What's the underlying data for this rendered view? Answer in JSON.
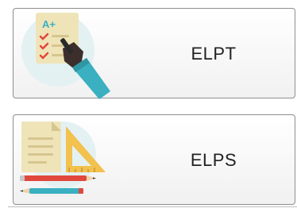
{
  "tiles": [
    {
      "label": "ELPT",
      "icon": "graded-test-icon"
    },
    {
      "label": "ELPS",
      "icon": "stationery-icon"
    }
  ],
  "colors": {
    "tile_border": "#8e8e8e",
    "tile_bg": "#f4f4f4",
    "icon_circle": "#e4f1f3",
    "paper": "#efe4b8",
    "check": "#e0483c",
    "grade_text": "#3ab0c0",
    "ruler": "#f2c14e",
    "pencil_red": "#e0483c",
    "pencil_blue": "#3ab0c0"
  }
}
